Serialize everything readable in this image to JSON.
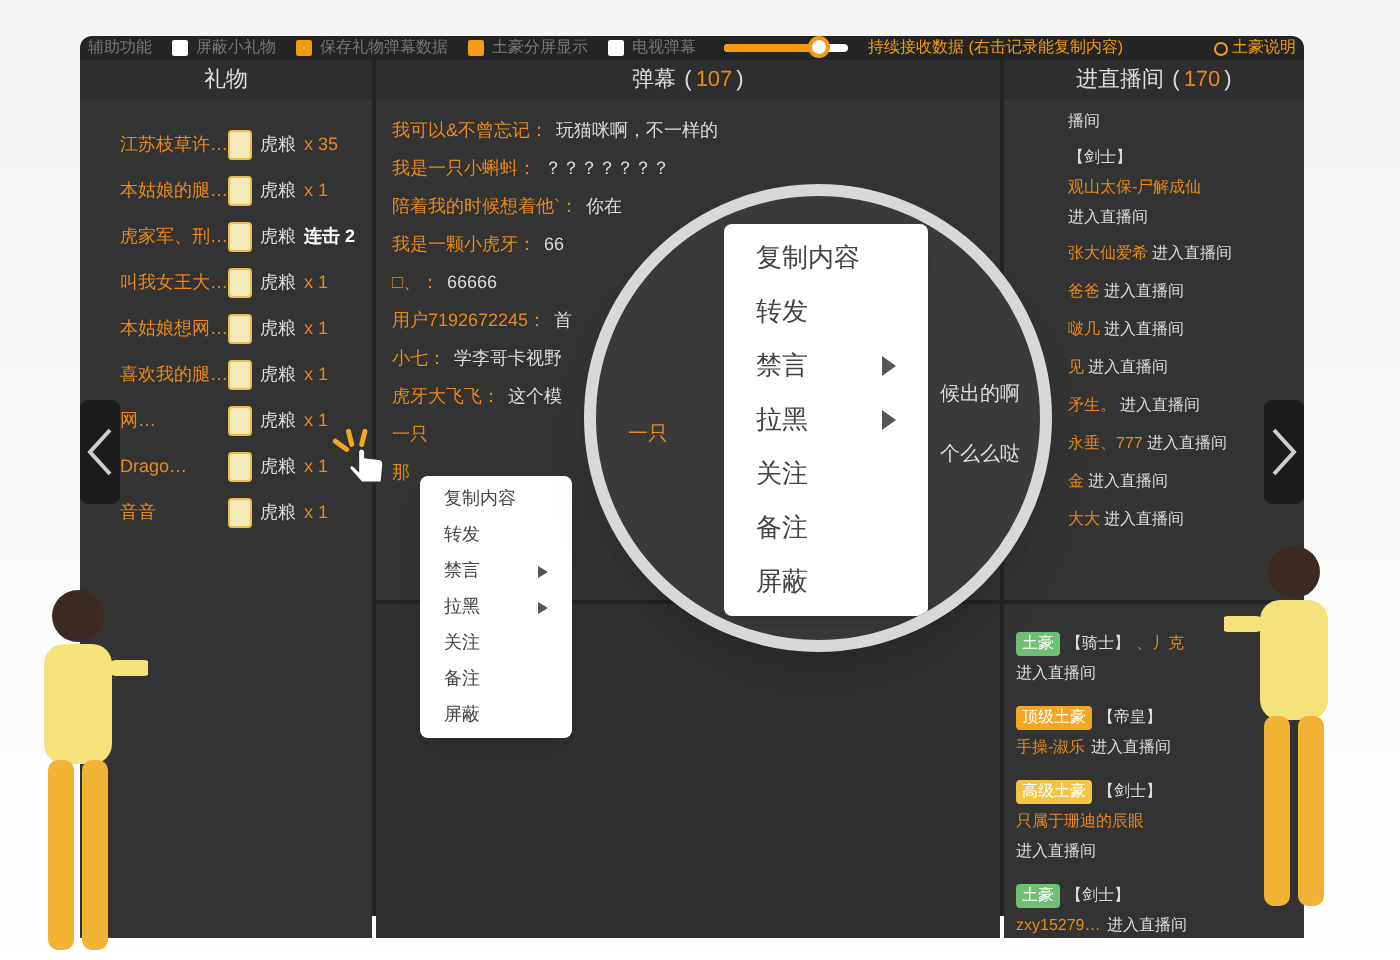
{
  "toolbar": {
    "label": "辅助功能",
    "options": [
      {
        "label": "屏蔽小礼物",
        "checked": false
      },
      {
        "label": "保存礼物弹幕数据",
        "checked": true
      },
      {
        "label": "土豪分屏显示",
        "checked": true
      },
      {
        "label": "电视弹幕",
        "checked": false
      }
    ],
    "slider": {
      "level": 0.78,
      "label": "持续接收数据 (右击记录能复制内容)"
    },
    "help": "土豪说明"
  },
  "gifts": {
    "title": "礼物",
    "rows": [
      {
        "user": "江苏枝草许…",
        "gift": "虎粮",
        "kind": "count",
        "amount": "x 35"
      },
      {
        "user": "本姑娘的腿…",
        "gift": "虎粮",
        "kind": "count",
        "amount": "x 1"
      },
      {
        "user": "虎家军、刑…",
        "gift": "虎粮",
        "kind": "combo",
        "amount": "连击 2"
      },
      {
        "user": "叫我女王大…",
        "gift": "虎粮",
        "kind": "count",
        "amount": "x 1"
      },
      {
        "user": "本姑娘想网…",
        "gift": "虎粮",
        "kind": "count",
        "amount": "x 1"
      },
      {
        "user": "喜欢我的腿…",
        "gift": "虎粮",
        "kind": "count",
        "amount": "x 1"
      },
      {
        "user": "网…",
        "gift": "虎粮",
        "kind": "count",
        "amount": "x 1"
      },
      {
        "user": "Drago…",
        "gift": "虎粮",
        "kind": "count",
        "amount": "x 1"
      },
      {
        "user": "音音",
        "gift": "虎粮",
        "kind": "count",
        "amount": "x 1"
      }
    ]
  },
  "danmu": {
    "title": "弹幕",
    "open": "(",
    "count": "107",
    "close": ")",
    "rows": [
      {
        "user": "我可以&不曾忘记：",
        "text": "玩猫咪啊，不一样的"
      },
      {
        "user": "我是一只小蝌蚪：",
        "text": "？？？？？？？"
      },
      {
        "user": "陪着我的时候想着他`：",
        "text": "你在"
      },
      {
        "user": "我是一颗小虎牙：",
        "text": "66"
      },
      {
        "user": "□、：",
        "text": "66666"
      },
      {
        "user": "用户7192672245：",
        "text": "首"
      },
      {
        "user": "小七：",
        "text": "学李哥卡视野"
      },
      {
        "user": "虎牙大飞飞：",
        "text": "这个模"
      },
      {
        "user": "一只"
      },
      {
        "user": "那"
      }
    ]
  },
  "entries": {
    "title": "进直播间",
    "open": "(",
    "count": "170",
    "close": ")",
    "rows": [
      {
        "text": "播间"
      },
      {
        "rank": "【剑士】",
        "name": "观山太保-尸解成仙",
        "text": "进入直播间"
      },
      {
        "name": "张大仙爱希",
        "text": "进入直播间"
      },
      {
        "name": "爸爸",
        "text": "进入直播间"
      },
      {
        "name": "啵几",
        "text": "进入直播间"
      },
      {
        "name": "见",
        "text": "进入直播间"
      },
      {
        "name": "矛生。",
        "text": "进入直播间"
      },
      {
        "name": "永垂、777",
        "text": "进入直播间"
      },
      {
        "name": "金",
        "text": "进入直播间"
      },
      {
        "name": "大大",
        "text": "进入直播间"
      }
    ],
    "vip_rows": [
      {
        "badge": "土豪",
        "color": "#6fbf73",
        "rank": "【骑士】",
        "name": "、丿克",
        "text": "进入直播间"
      },
      {
        "badge": "顶级土豪",
        "color": "#f5a623",
        "rank": "【帝皇】",
        "name": "手操-淑乐",
        "text": "进入直播间"
      },
      {
        "badge": "高级土豪",
        "color": "#f5c542",
        "rank": "【剑士】",
        "name": "只属于珊迪的辰眼",
        "text": "进入直播间"
      },
      {
        "badge": "土豪",
        "color": "#6fbf73",
        "rank": "【剑士】",
        "name": "zxy15279…",
        "text": "进入直播间"
      }
    ]
  },
  "context_menu": [
    {
      "label": "复制内容",
      "submenu": false
    },
    {
      "label": "转发",
      "submenu": false
    },
    {
      "label": "禁言",
      "submenu": true
    },
    {
      "label": "拉黑",
      "submenu": true
    },
    {
      "label": "关注",
      "submenu": false
    },
    {
      "label": "备注",
      "submenu": false
    },
    {
      "label": "屏蔽",
      "submenu": false
    }
  ],
  "magnifier": {
    "background_texts": [
      "候出的啊",
      "一只",
      "个么么哒"
    ],
    "menu": [
      {
        "label": "复制内容",
        "submenu": false
      },
      {
        "label": "转发",
        "submenu": false
      },
      {
        "label": "禁言",
        "submenu": true
      },
      {
        "label": "拉黑",
        "submenu": true
      },
      {
        "label": "关注",
        "submenu": false
      },
      {
        "label": "备注",
        "submenu": false
      },
      {
        "label": "屏蔽",
        "submenu": false
      }
    ]
  }
}
